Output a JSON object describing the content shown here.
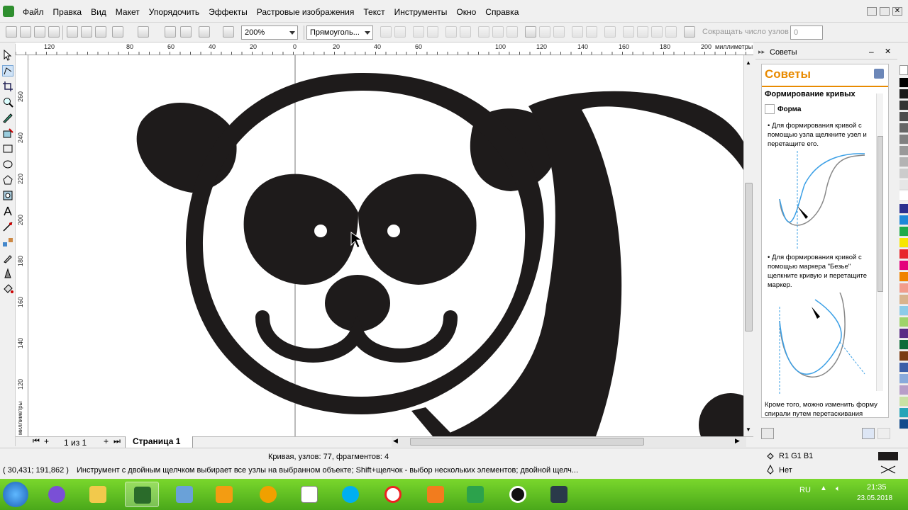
{
  "menu": {
    "items": [
      "Файл",
      "Правка",
      "Вид",
      "Макет",
      "Упорядочить",
      "Эффекты",
      "Растровые изображения",
      "Текст",
      "Инструменты",
      "Окно",
      "Справка"
    ]
  },
  "toolbar": {
    "zoom_value": "200%",
    "shape_combo": "Прямоуголь...",
    "reduce_nodes_label": "Сокращать число узлов",
    "reduce_nodes_value": "0"
  },
  "ruler": {
    "h_labels": [
      "120",
      "80",
      "60",
      "40",
      "20",
      "0",
      "20",
      "40",
      "60",
      "100",
      "120",
      "140",
      "160",
      "180",
      "200"
    ],
    "h_unit": "миллиметры",
    "v_labels": [
      "260",
      "240",
      "220",
      "200",
      "180",
      "160",
      "140",
      "120"
    ],
    "v_unit": "миллиметры"
  },
  "pagebar": {
    "page_count": "1 из 1",
    "page_tab": "Страница 1"
  },
  "docker": {
    "tab_title": "Советы",
    "heading": "Советы",
    "section_title": "Формирование кривых",
    "tool_name": "Форма",
    "tip1": "Для формирования кривой с помощью узла щелкните узел и перетащите его.",
    "tip2": "Для формирования кривой с помощью маркера \"Безье\" щелкните кривую и перетащите маркер.",
    "tip3": "Кроме того, можно изменить форму спирали путем перетаскивания любого маркера"
  },
  "status": {
    "object_info": "Кривая, узлов: 77, фрагментов: 4",
    "coords": "( 30,431; 191,862 )",
    "hint": "Инструмент с двойным щелчком выбирает все узлы на выбранном объекте; Shift+щелчок - выбор нескольких элементов; двойной щелч...",
    "fill_label": "R1 G1 B1",
    "outline_label": "Нет",
    "fill_color": "#1e1b1b"
  },
  "taskbar": {
    "lang": "RU",
    "time": "21:35",
    "date": "23.05.2018",
    "apps": [
      "start-orb",
      "microphone-app",
      "file-explorer",
      "corel-draw",
      "presentation-app",
      "media-player",
      "mail-app",
      "calculator-app",
      "skype-app",
      "yandex-browser",
      "game-app",
      "green-app",
      "record-app",
      "editor-app"
    ]
  },
  "colors": {
    "artwork": "#1e1b1b",
    "accent_orange": "#e88a00",
    "taskbar_green": "#5cbc22"
  }
}
